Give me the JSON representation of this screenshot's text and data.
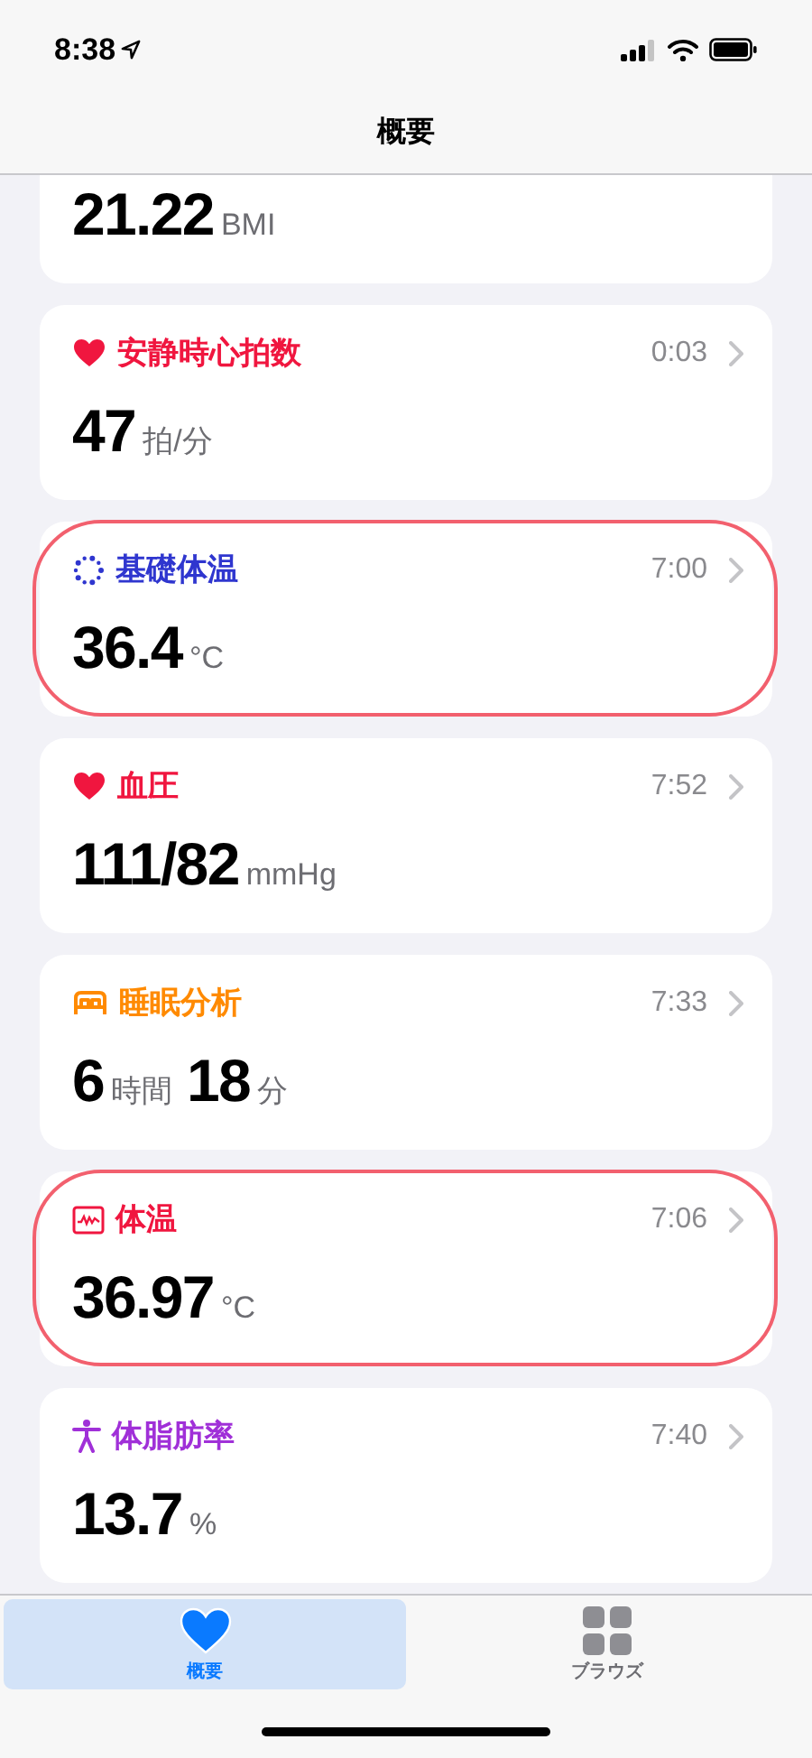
{
  "status_bar": {
    "time": "8:38"
  },
  "nav_bar": {
    "title": "概要"
  },
  "cards": [
    {
      "kind": "partial",
      "circled": false,
      "value": [
        {
          "number": "21.22",
          "unit": "BMI"
        }
      ]
    },
    {
      "kind": "full",
      "color": "#f0163f",
      "title": "安静時心拍数",
      "time": "0:03",
      "circled": false,
      "value": [
        {
          "number": "47",
          "unit": "拍/分"
        }
      ]
    },
    {
      "kind": "full",
      "color": "#2f36cf",
      "title": "基礎体温",
      "time": "7:00",
      "circled": true,
      "value": [
        {
          "number": "36.4",
          "unit": "°C"
        }
      ]
    },
    {
      "kind": "full",
      "color": "#f0163f",
      "title": "血圧",
      "time": "7:52",
      "circled": false,
      "value": [
        {
          "number": "111/82",
          "unit": "mmHg"
        }
      ]
    },
    {
      "kind": "full",
      "color": "#ff8a00",
      "title": "睡眠分析",
      "time": "7:33",
      "circled": false,
      "value": [
        {
          "number": "6",
          "unit": "時間"
        },
        {
          "number": "18",
          "unit": "分"
        }
      ]
    },
    {
      "kind": "full",
      "color": "#f0163f",
      "title": "体温",
      "time": "7:06",
      "circled": true,
      "value": [
        {
          "number": "36.97",
          "unit": "°C"
        }
      ]
    },
    {
      "kind": "full",
      "color": "#a030d8",
      "title": "体脂肪率",
      "time": "7:40",
      "circled": false,
      "value": [
        {
          "number": "13.7",
          "unit": "%"
        }
      ]
    }
  ],
  "tab_bar": [
    {
      "label": "概要",
      "selected": true
    },
    {
      "label": "ブラウズ",
      "selected": false
    }
  ]
}
